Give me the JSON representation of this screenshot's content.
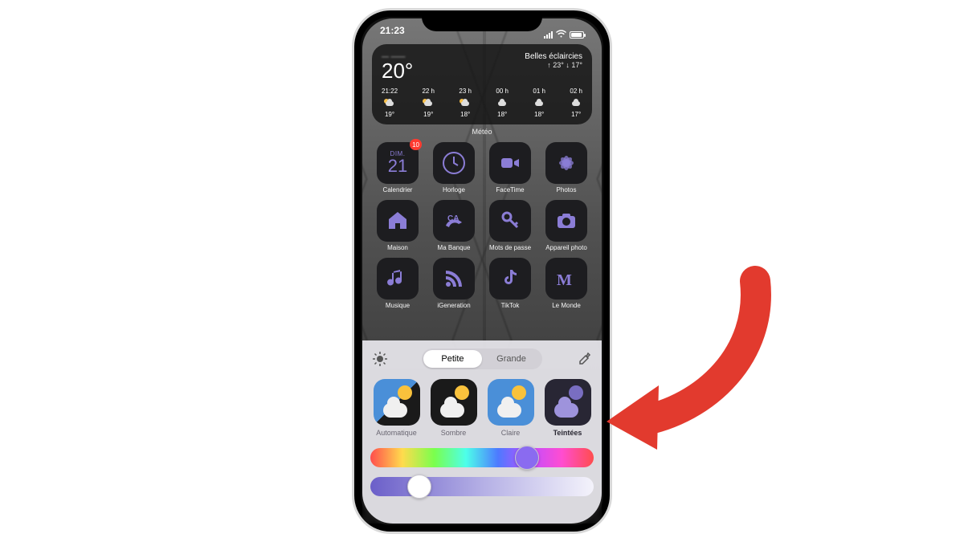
{
  "status": {
    "time": "21:23"
  },
  "weather": {
    "location": "— ——",
    "temp": "20°",
    "condition": "Belles éclaircies",
    "high": "23°",
    "low": "17°",
    "label": "Météo",
    "hours": [
      {
        "t": "21:22",
        "temp": "19°"
      },
      {
        "t": "22 h",
        "temp": "19°"
      },
      {
        "t": "23 h",
        "temp": "18°"
      },
      {
        "t": "00 h",
        "temp": "18°"
      },
      {
        "t": "01 h",
        "temp": "18°"
      },
      {
        "t": "02 h",
        "temp": "17°"
      }
    ]
  },
  "calendar": {
    "day": "DIM.",
    "date": "21",
    "badge": "10"
  },
  "apps": [
    {
      "label": "Calendrier"
    },
    {
      "label": "Horloge"
    },
    {
      "label": "FaceTime"
    },
    {
      "label": "Photos"
    },
    {
      "label": "Maison"
    },
    {
      "label": "Ma Banque"
    },
    {
      "label": "Mots de passe"
    },
    {
      "label": "Appareil photo"
    },
    {
      "label": "Musique"
    },
    {
      "label": "iGeneration"
    },
    {
      "label": "TikTok"
    },
    {
      "label": "Le Monde"
    }
  ],
  "sheet": {
    "size": {
      "small": "Petite",
      "large": "Grande"
    },
    "styles": {
      "auto": "Automatique",
      "dark": "Sombre",
      "light": "Claire",
      "tint": "Teintées"
    },
    "hue_pos": 0.7,
    "sat_pos": 0.22
  },
  "accent": "#8b7dd6"
}
